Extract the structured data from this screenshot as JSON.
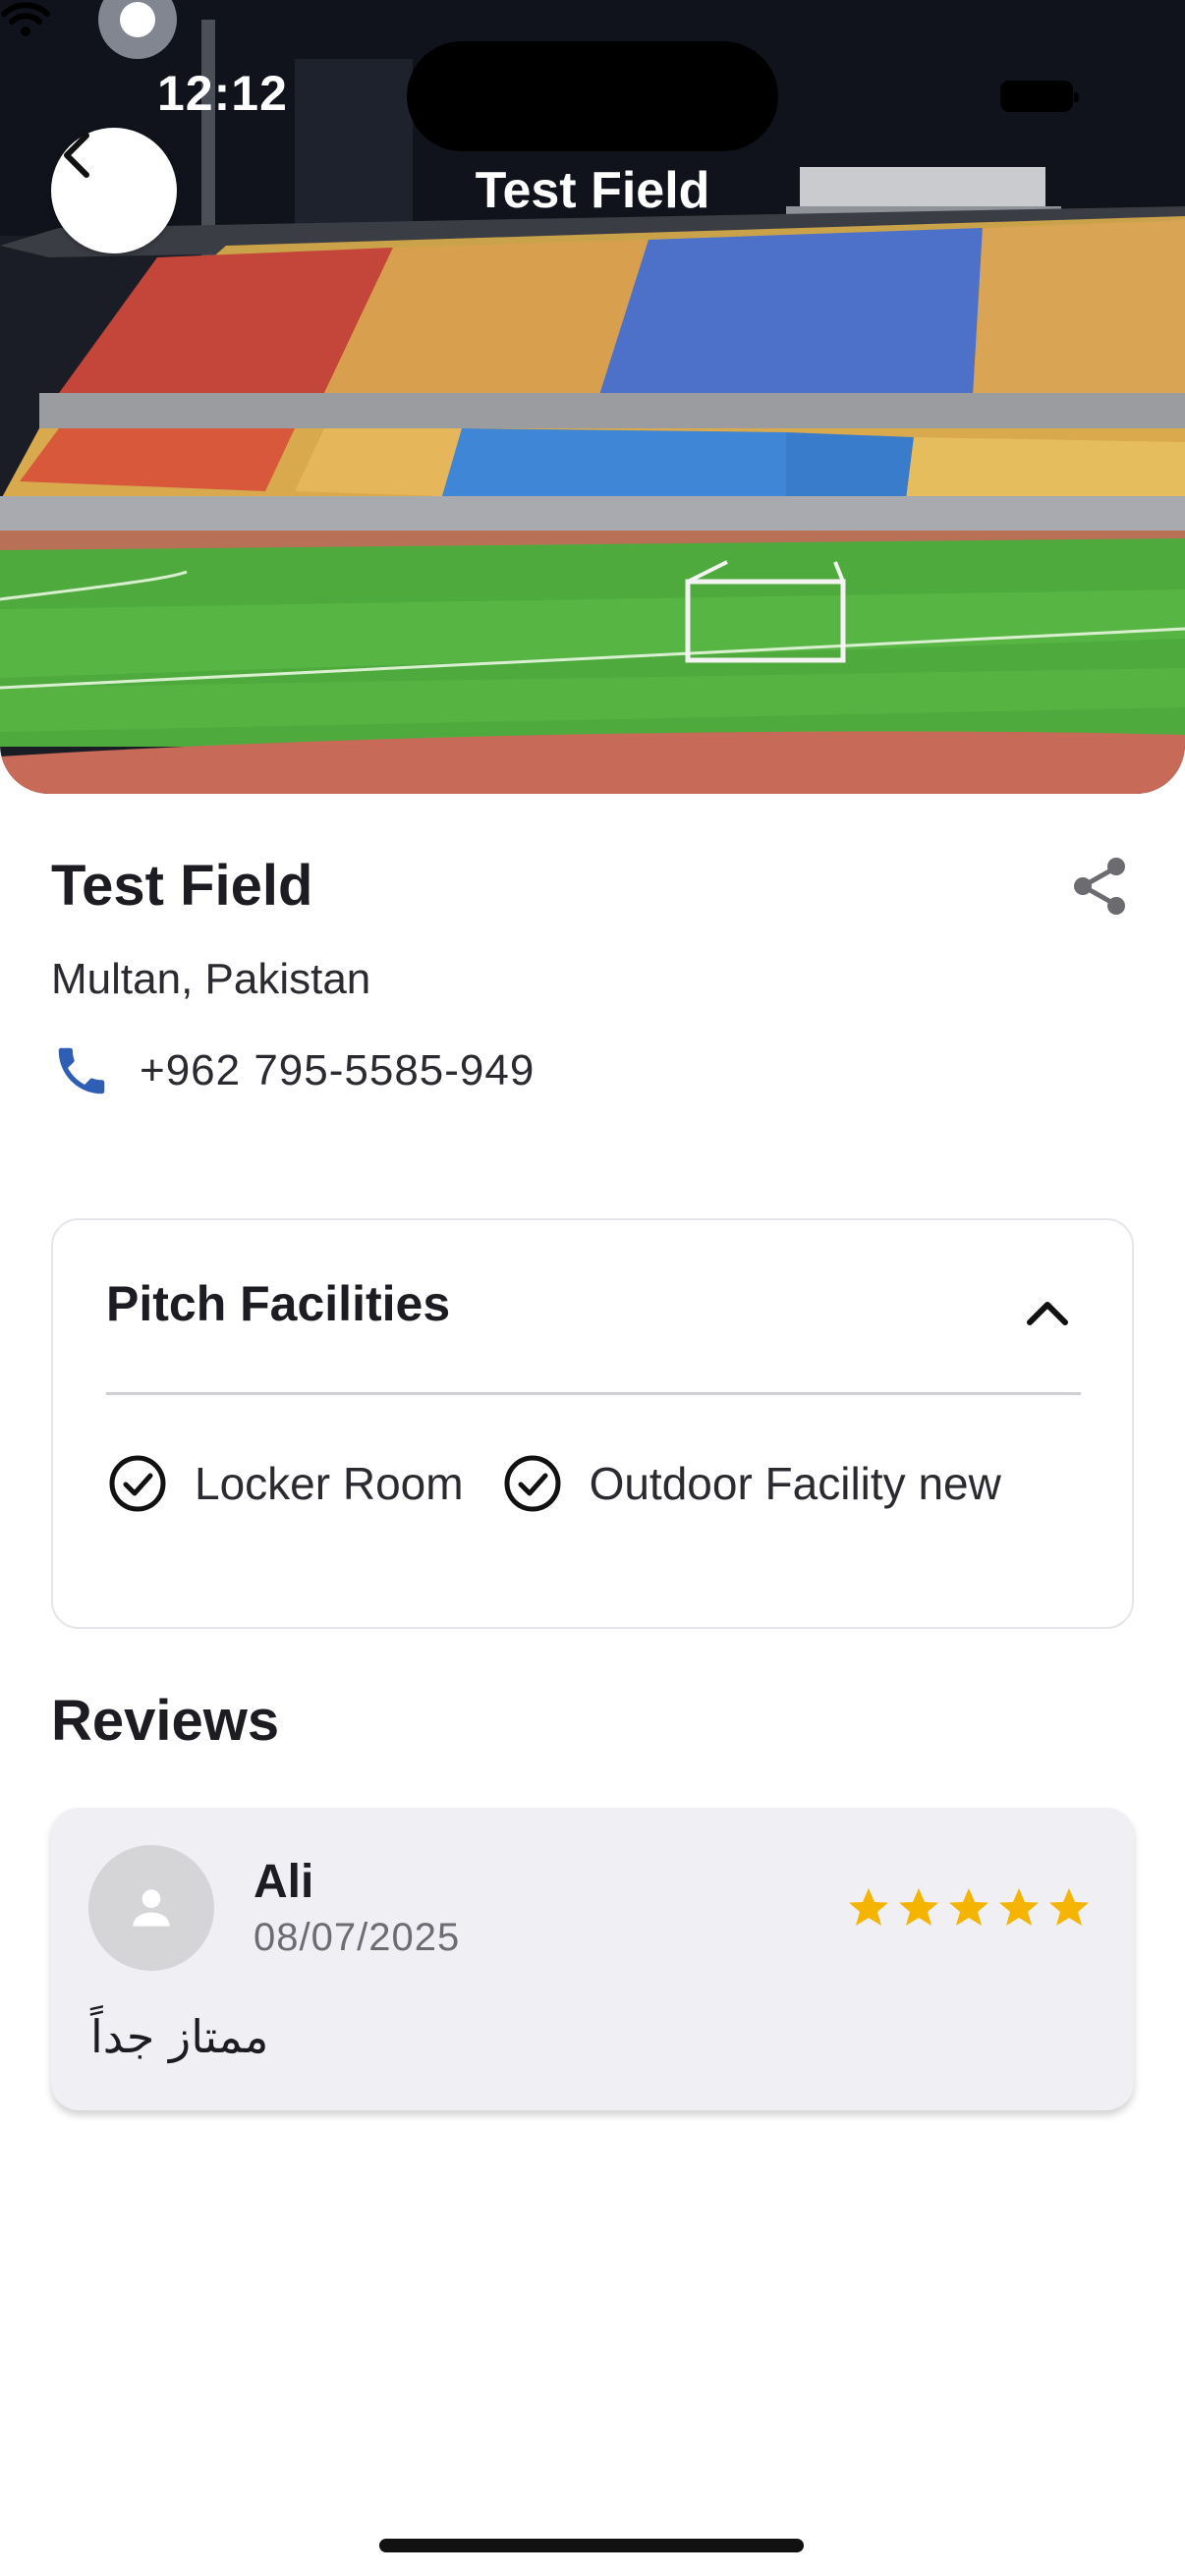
{
  "status_bar": {
    "time": "12:12"
  },
  "header": {
    "title": "Test Field"
  },
  "field": {
    "name": "Test Field",
    "location": "Multan, Pakistan",
    "phone": "+962 795-5585-949"
  },
  "facilities": {
    "title": "Pitch Facilities",
    "items": [
      {
        "label": "Locker Room"
      },
      {
        "label": "Outdoor Facility new"
      }
    ]
  },
  "reviews": {
    "heading": "Reviews",
    "items": [
      {
        "name": "Ali",
        "date": "08/07/2025",
        "rating": 5,
        "text": "ممتاز جداً"
      }
    ]
  },
  "colors": {
    "accent_phone": "#2f5fb4",
    "star": "#f5b400",
    "card_bg": "#efeff4"
  },
  "icons": [
    "chevron-left-icon",
    "share-icon",
    "phone-icon",
    "chevron-up-icon",
    "check-circle-icon",
    "person-icon",
    "star-icon",
    "wifi-icon",
    "battery-icon"
  ]
}
